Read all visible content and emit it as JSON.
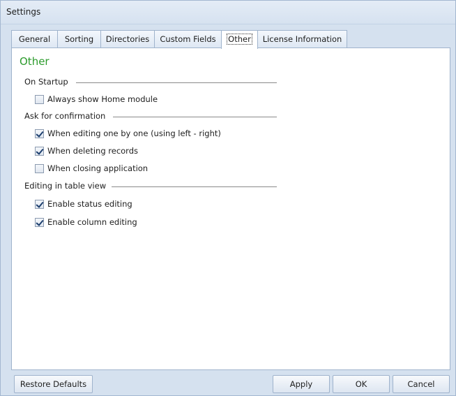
{
  "window": {
    "title": "Settings"
  },
  "tabs": [
    {
      "label": "General"
    },
    {
      "label": "Sorting"
    },
    {
      "label": "Directories"
    },
    {
      "label": "Custom Fields"
    },
    {
      "label": "Other",
      "active": true
    },
    {
      "label": "License Information"
    }
  ],
  "panel": {
    "heading": "Other",
    "heading_color": "#2c9b2c",
    "groups": [
      {
        "label": "On Startup",
        "options": [
          {
            "label": "Always show Home module",
            "checked": false
          }
        ]
      },
      {
        "label": "Ask for confirmation",
        "options": [
          {
            "label": "When editing one by one (using left - right)",
            "checked": true
          },
          {
            "label": "When deleting records",
            "checked": true
          },
          {
            "label": "When closing application",
            "checked": false
          }
        ]
      },
      {
        "label": "Editing in table view",
        "options": [
          {
            "label": "Enable status editing",
            "checked": true
          },
          {
            "label": "Enable column editing",
            "checked": true
          }
        ]
      }
    ]
  },
  "footer": {
    "restore_label": "Restore Defaults",
    "apply_label": "Apply",
    "ok_label": "OK",
    "cancel_label": "Cancel"
  }
}
